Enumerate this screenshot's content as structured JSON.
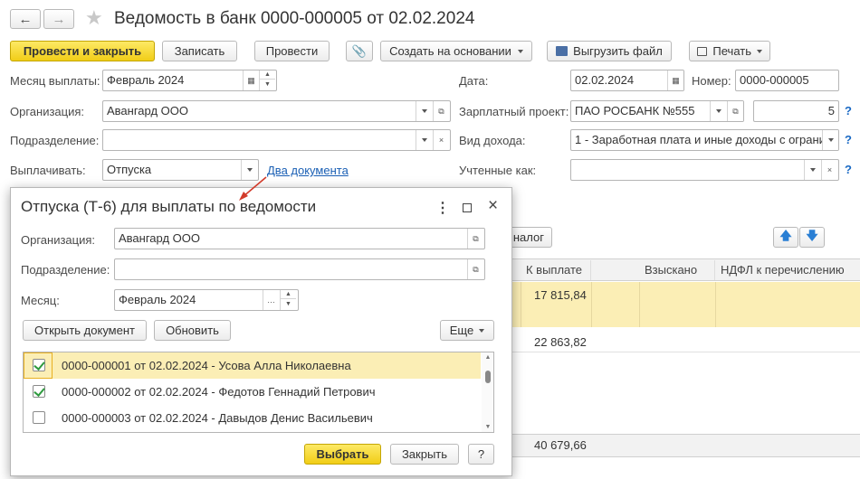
{
  "window": {
    "title": "Ведомость в банк 0000-000005 от 02.02.2024"
  },
  "toolbar": {
    "post_close": "Провести и закрыть",
    "save": "Записать",
    "post": "Провести",
    "create_based": "Создать на основании",
    "upload_file": "Выгрузить файл",
    "print": "Печать"
  },
  "form": {
    "month_label": "Месяц выплаты:",
    "month_value": "Февраль 2024",
    "org_label": "Организация:",
    "org_value": "Авангард ООО",
    "dept_label": "Подразделение:",
    "dept_value": "",
    "pay_label": "Выплачивать:",
    "pay_value": "Отпуска",
    "docs_link": "Два документа",
    "date_label": "Дата:",
    "date_value": "02.02.2024",
    "number_label": "Номер:",
    "number_value": "0000-000005",
    "salary_label": "Зарплатный проект:",
    "salary_value": "ПАО РОСБАНК №555",
    "salary_num": "5",
    "income_label": "Вид дохода:",
    "income_value": "1 - Заработная плата и иные доходы с ограни",
    "counted_label": "Учтенные как:",
    "counted_value": "",
    "help": "?"
  },
  "behind": {
    "tax_btn": "налог",
    "headers": [
      "К выплате",
      "Взыскано",
      "НДФЛ к перечислению"
    ],
    "row1_value": "17 815,84",
    "row2_value": "22 863,82",
    "total": "40 679,66"
  },
  "dialog": {
    "title": "Отпуска (Т-6) для выплаты по ведомости",
    "org_label": "Организация:",
    "org_value": "Авангард ООО",
    "dept_label": "Подразделение:",
    "dept_value": "",
    "month_label": "Месяц:",
    "month_value": "Февраль 2024",
    "open_doc": "Открыть документ",
    "refresh": "Обновить",
    "more": "Еще",
    "rows": [
      {
        "text": "0000-000001 от 02.02.2024 - Усова Алла Николаевна",
        "checked": true
      },
      {
        "text": "0000-000002 от 02.02.2024 - Федотов Геннадий Петрович",
        "checked": true
      },
      {
        "text": "0000-000003 от 02.02.2024 - Давыдов Денис Васильевич",
        "checked": false
      }
    ],
    "select": "Выбрать",
    "close": "Закрыть",
    "help": "?"
  },
  "colors": {
    "accent_yellow": "#f1cd17",
    "selection_row": "#fbeeb5",
    "link_blue": "#1a5fb4",
    "check_green": "#2e9a3e",
    "arrow_red": "#d23b2b"
  }
}
